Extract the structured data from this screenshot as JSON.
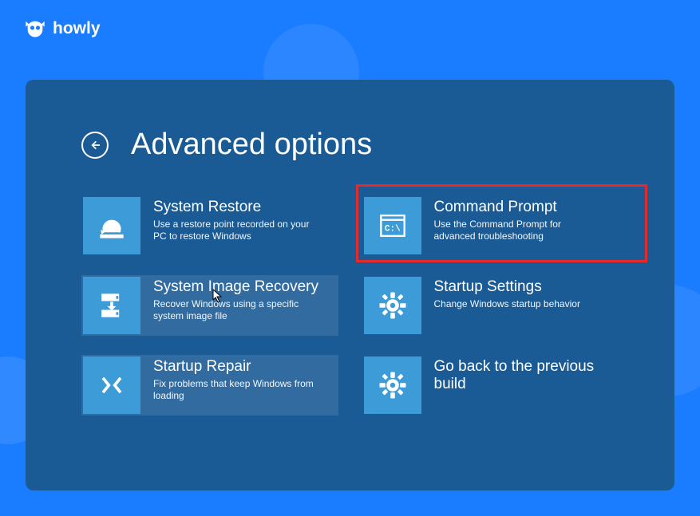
{
  "brand": {
    "name": "howly"
  },
  "header": {
    "title": "Advanced options"
  },
  "options": [
    {
      "title": "System Restore",
      "desc": "Use a restore point recorded on your PC to restore Windows"
    },
    {
      "title": "Command Prompt",
      "desc": "Use the Command Prompt for advanced troubleshooting"
    },
    {
      "title": "System Image Recovery",
      "desc": "Recover Windows using a specific system image file"
    },
    {
      "title": "Startup Settings",
      "desc": "Change Windows startup behavior"
    },
    {
      "title": "Startup Repair",
      "desc": "Fix problems that keep Windows from loading"
    },
    {
      "title": "Go back to the previous build",
      "desc": ""
    }
  ]
}
